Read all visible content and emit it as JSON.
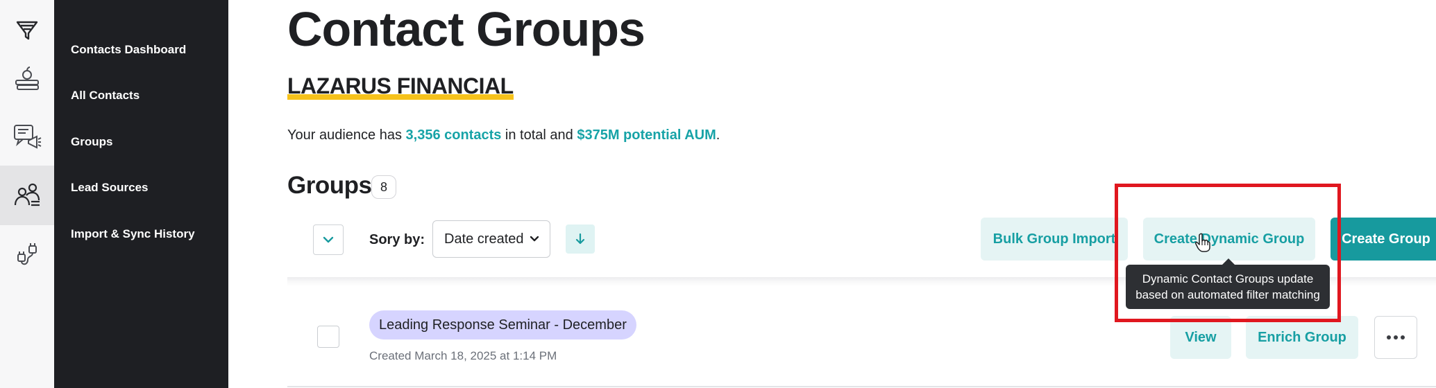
{
  "rail": {
    "items": [
      {
        "icon": "funnel-icon"
      },
      {
        "icon": "books-apple-icon"
      },
      {
        "icon": "megaphone-chat-icon"
      },
      {
        "icon": "people-icon",
        "active": true
      },
      {
        "icon": "plug-cable-icon"
      }
    ]
  },
  "sidebar": {
    "items": [
      {
        "label": "Contacts Dashboard"
      },
      {
        "label": "All Contacts"
      },
      {
        "label": "Groups"
      },
      {
        "label": "Lead Sources"
      },
      {
        "label": "Import & Sync History"
      }
    ]
  },
  "page": {
    "title": "Contact Groups",
    "org_name": "LAZARUS FINANCIAL",
    "summary": {
      "prefix": "Your audience has ",
      "contacts": "3,356 contacts",
      "middle": " in total and ",
      "aum": "$375M potential AUM",
      "suffix": "."
    }
  },
  "groups_section": {
    "heading": "Groups",
    "count": "8",
    "sort_label": "Sory by:",
    "sort_value": "Date created",
    "buttons": {
      "bulk_import": "Bulk Group Import",
      "create_dynamic": "Create Dynamic Group",
      "create_group": "Create Group"
    },
    "tooltip": {
      "line1": "Dynamic Contact Groups update",
      "line2": "based on automated filter matching"
    }
  },
  "groups": [
    {
      "name": "Leading Response Seminar - December",
      "created": "Created March 18, 2025 at 1:14 PM",
      "view_label": "View",
      "enrich_label": "Enrich Group"
    }
  ],
  "colors": {
    "accent": "#179a9e",
    "accent_light": "#e5f4f4",
    "sidebar_bg": "#1e1f23",
    "highlight_underline": "#f6c21b",
    "pill_bg": "#d6d4ff",
    "annotation_red": "#e0171f"
  }
}
